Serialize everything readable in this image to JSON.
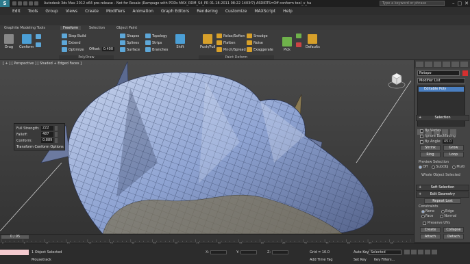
{
  "titlebar": {
    "logo": "S",
    "title": "Autodesk 3ds Max 2012 x64 pre-release - Not for Resale (Rampage with PODs MAX_RDM_S4_PR 01-18-2011 08:22 1403f7) ASDIRTS=Off   conform tool_v_halfcowsmell v04.max",
    "search_placeholder": "Type a keyword or phrase"
  },
  "menu": [
    "Edit",
    "Tools",
    "Group",
    "Views",
    "Create",
    "Modifiers",
    "Animation",
    "Graph Editors",
    "Rendering",
    "Customize",
    "MAXScript",
    "Help"
  ],
  "ribbon_tabs": {
    "header": "Graphite Modeling Tools",
    "freeform": "Freeform",
    "selection": "Selection",
    "object_paint": "Object Paint"
  },
  "ribbon": {
    "drag": "Drag",
    "conform": "Conform",
    "step_build": "Step Build",
    "extend": "Extend",
    "optimize": "Optimize",
    "offset_label": "Offset:",
    "offset_value": "0.400",
    "shapes": "Shapes",
    "splines": "Splines",
    "surface": "Surface",
    "topology": "Topology",
    "strips": "Strips",
    "branches": "Branches",
    "shift": "Shift",
    "push_pull": "Push/Pull",
    "relax_soften": "Relax/Soften",
    "flatten": "Flatten",
    "pinch_spread": "Pinch/Spread",
    "smudge": "Smudge",
    "noise": "Noise",
    "exaggerate": "Exaggerate",
    "pick": "Pick",
    "defaults": "Defaults",
    "group_polydraw": "PolyDraw",
    "group_paint_deform": "Paint Deform"
  },
  "viewport": {
    "label": "[ + ] [ Perspective ] [ Shaded + Edged Faces ]"
  },
  "conform_panel": {
    "full_strength_label": "Full Strength:",
    "full_strength_value": "222",
    "falloff_label": "Falloff:",
    "falloff_value": "487",
    "conform_label": "Conform:",
    "conform_value": "0.889",
    "options": "Transform Conform Options"
  },
  "command_panel": {
    "object_name": "Retopo",
    "modifier_list": "Modifier List",
    "stack_item": "Editable Poly",
    "selection_header": "Selection",
    "by_vertex": "By Vertex",
    "ignore_backfacing": "Ignore Backfacing",
    "by_angle": "By Angle:",
    "angle_value": "45.0",
    "shrink": "Shrink",
    "grow": "Grow",
    "ring": "Ring",
    "loop": "Loop",
    "preview_selection": "Preview Selection",
    "off": "Off",
    "subobj": "SubObj",
    "multi": "Multi",
    "selection_status": "Whole Object Selected",
    "soft_selection": "Soft Selection",
    "edit_geometry": "Edit Geometry",
    "repeat_last": "Repeat Last",
    "constraints": "Constraints",
    "none": "None",
    "edge": "Edge",
    "face": "Face",
    "normal": "Normal",
    "preserve_uvs": "Preserve UVs",
    "create": "Create",
    "collapse": "Collapse",
    "attach": "Attach",
    "detach": "Detach"
  },
  "timeline": {
    "slider": "0 / 95",
    "ticks": [
      "0",
      "5",
      "10",
      "15",
      "20",
      "25",
      "30",
      "35",
      "40",
      "45",
      "50",
      "55",
      "60",
      "65",
      "70",
      "75",
      "80",
      "85",
      "90"
    ]
  },
  "status": {
    "objects_selected": "1 Object Selected",
    "prompt": "Mousetrack",
    "x_label": "X:",
    "y_label": "Y:",
    "z_label": "Z:",
    "grid": "Grid = 10.0",
    "add_time_tag": "Add Time Tag",
    "auto_key": "Auto Key",
    "set_key": "Set Key",
    "selected": "Selected",
    "key_filters": "Key Filters..."
  }
}
